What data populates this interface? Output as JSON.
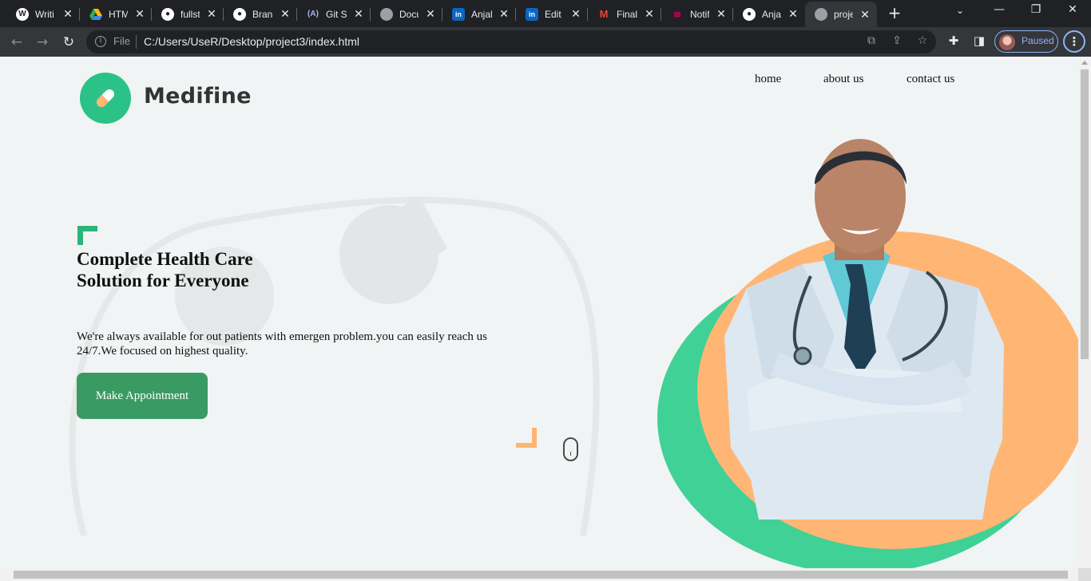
{
  "browser": {
    "tabs": [
      {
        "title": "Writi",
        "icon": "wordpress-icon"
      },
      {
        "title": "HTM",
        "icon": "google-drive-icon"
      },
      {
        "title": "fullst",
        "icon": "github-icon"
      },
      {
        "title": "Branc",
        "icon": "github-icon"
      },
      {
        "title": "Git Sl",
        "icon": "api-icon"
      },
      {
        "title": "Docu",
        "icon": "globe-icon"
      },
      {
        "title": "Anjal",
        "icon": "linkedin-icon"
      },
      {
        "title": "Edit I",
        "icon": "linkedin-icon"
      },
      {
        "title": "Final",
        "icon": "gmail-icon"
      },
      {
        "title": "Notif",
        "icon": "notification-icon"
      },
      {
        "title": "Anjal",
        "icon": "github-icon"
      },
      {
        "title": "proje",
        "icon": "globe-icon",
        "active": true
      }
    ],
    "new_tab_label": "+",
    "omnibox": {
      "scheme_label": "File",
      "url": "C:/Users/UseR/Desktop/project3/index.html"
    },
    "profile_label": "Paused"
  },
  "site": {
    "brand": "Medifine",
    "nav": [
      "home",
      "about us",
      "contact us"
    ],
    "hero": {
      "title": "Complete Health Care Solution for Everyone",
      "description": "We're always available for out patients with emergen problem.you can easily reach us 24/7.We focused on highest quality.",
      "cta_label": "Make Appointment"
    },
    "colors": {
      "brand_green": "#2bc287",
      "button_green": "#3a9b62",
      "accent_orange": "#ffb675",
      "blob_green": "#40d196",
      "page_bg": "#f1f4f4"
    }
  }
}
